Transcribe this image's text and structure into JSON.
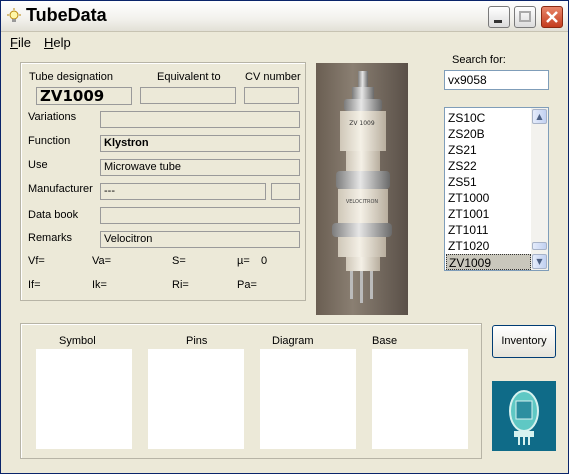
{
  "window": {
    "title": "TubeData"
  },
  "menu": [
    {
      "label": "File",
      "accel": "F",
      "rest": "ile"
    },
    {
      "label": "Help",
      "accel": "H",
      "rest": "elp"
    }
  ],
  "fields": {
    "tube_designation_label": "Tube designation",
    "equivalent_label": "Equivalent to",
    "cv_label": "CV number",
    "designation_value": "ZV1009",
    "equivalent_value": "",
    "cv_value": "",
    "variations_label": "Variations",
    "variations_value": "",
    "function_label": "Function",
    "function_value": "Klystron",
    "use_label": "Use",
    "use_value": "Microwave tube",
    "manufacturer_label": "Manufacturer",
    "manufacturer_value": "---",
    "manufacturer_code": "",
    "databook_label": "Data book",
    "databook_value": "",
    "remarks_label": "Remarks",
    "remarks_value": "Velocitron"
  },
  "params": {
    "vf": "Vf=",
    "va": "Va=",
    "s": "S=",
    "mu": "µ=",
    "mu_value": "0",
    "if": "If=",
    "ik": "Ik=",
    "ri": "Ri=",
    "pa": "Pa="
  },
  "photo_labels": {
    "top": "ZV 1009",
    "middle": "VELOCITRON"
  },
  "search": {
    "label": "Search for:",
    "value": "vx9058"
  },
  "tube_list": [
    "ZS10C",
    "ZS20B",
    "ZS21",
    "ZS22",
    "ZS51",
    "ZT1000",
    "ZT1001",
    "ZT1011",
    "ZT1020",
    "ZV1009"
  ],
  "selected_tube": "ZV1009",
  "bottom_tabs": {
    "symbol": "Symbol",
    "pins": "Pins",
    "diagram": "Diagram",
    "base": "Base"
  },
  "buttons": {
    "inventory": "Inventory"
  },
  "colors": {
    "title_close": "#c43c1e",
    "selection": "#c9c7bc",
    "logo_bg": "#0f6b88"
  }
}
